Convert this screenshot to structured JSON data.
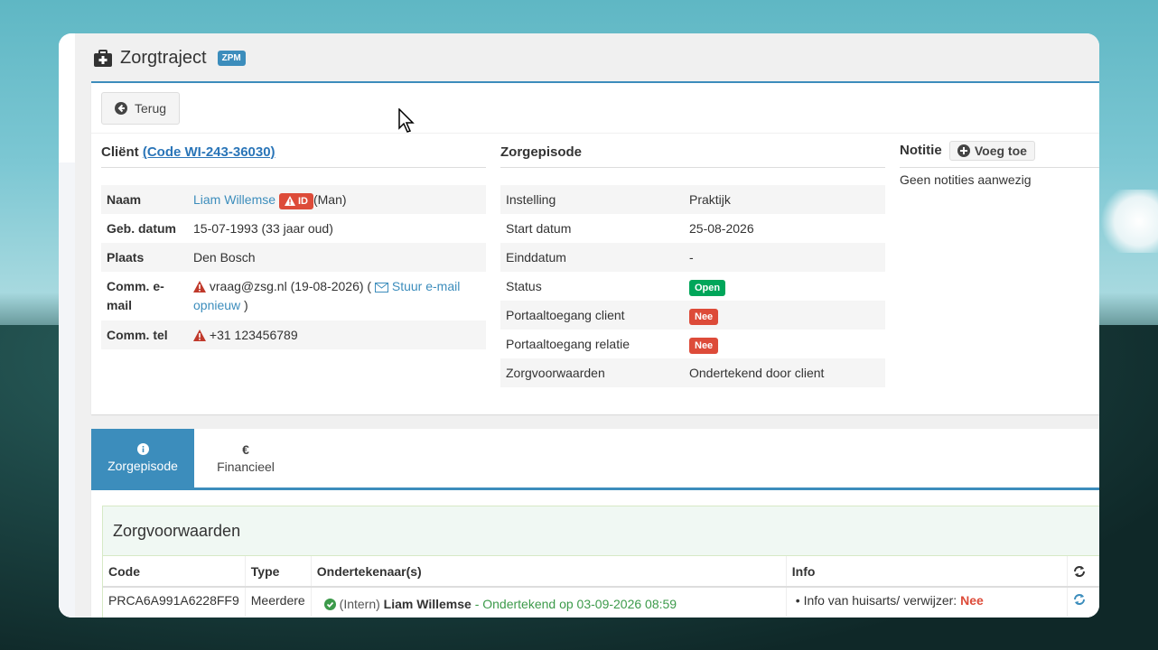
{
  "page": {
    "title": "Zorgtraject",
    "badge": "ZPM",
    "back_label": "Terug"
  },
  "client": {
    "title_prefix": "Cliënt",
    "code_link": "(Code WI-243-36030)",
    "rows": [
      {
        "key": "Naam",
        "name": "Liam Willemse",
        "id_badge": "ID",
        "gender": "(Man)"
      },
      {
        "key": "Geb. datum",
        "value": "15-07-1993 (33 jaar oud)"
      },
      {
        "key": "Plaats",
        "value": "Den Bosch"
      },
      {
        "key": "Comm. e-mail",
        "email": "vraag@zsg.nl (19-08-2026) (",
        "resend": "Stuur e-mail opnieuw",
        "close": ")"
      },
      {
        "key": "Comm. tel",
        "value": "+31 123456789"
      }
    ]
  },
  "episode": {
    "title": "Zorgepisode",
    "rows": [
      {
        "key": "Instelling",
        "value": "Praktijk"
      },
      {
        "key": "Start datum",
        "value": "25-08-2026"
      },
      {
        "key": "Einddatum",
        "value": "-"
      },
      {
        "key": "Status",
        "value": "Open",
        "color": "#00a65a"
      },
      {
        "key": "Portaaltoegang client",
        "value": "Nee",
        "color": "#dd4b39"
      },
      {
        "key": "Portaaltoegang relatie",
        "value": "Nee",
        "color": "#dd4b39"
      },
      {
        "key": "Zorgvoorwaarden",
        "value": "Ondertekend door client"
      }
    ]
  },
  "notes": {
    "title": "Notitie",
    "add_label": "Voeg toe",
    "empty": "Geen notities aanwezig"
  },
  "tabs": [
    {
      "icon": "info-icon",
      "label": "Zorgepisode",
      "active": true
    },
    {
      "icon": "euro-icon",
      "label": "Financieel",
      "active": false
    }
  ],
  "conditions": {
    "title": "Zorgvoorwaarden",
    "headers": [
      "Code",
      "Type",
      "Ondertekenaar(s)",
      "Info"
    ],
    "row": {
      "code": "PRCA6A991A6228FF9",
      "type": "Meerdere",
      "signer_prefix": "(Intern)",
      "signer_name": "Liam Willemse",
      "signed": "- Ondertekend op 03-09-2026 08:59",
      "info_label": "Info van huisarts/ verwijzer:",
      "info_value": "Nee"
    }
  },
  "colors": {
    "accent": "#3c8dbc",
    "danger": "#dd4b39",
    "success": "#00a65a"
  }
}
